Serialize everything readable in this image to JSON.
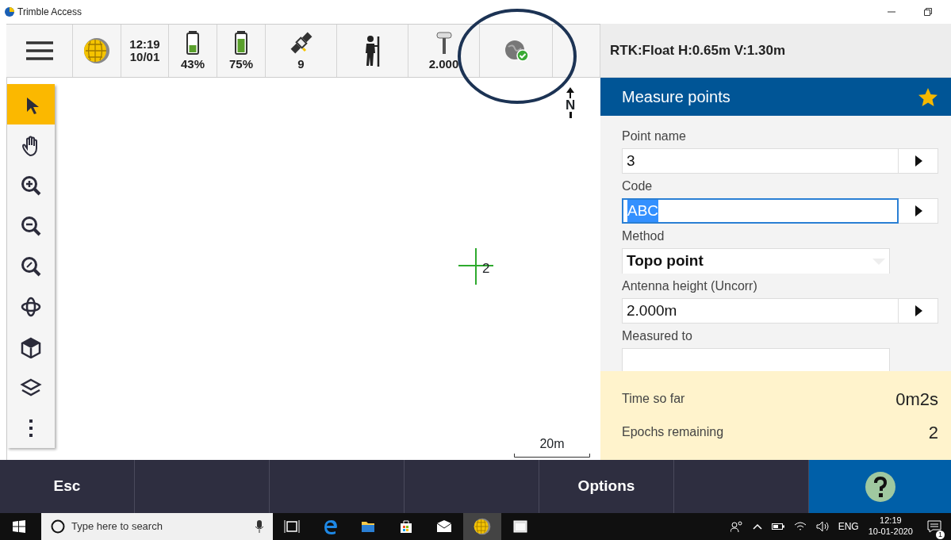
{
  "window": {
    "title": "Trimble Access"
  },
  "toolbar": {
    "items": [
      {
        "kind": "menu"
      },
      {
        "kind": "globe"
      },
      {
        "kind": "time",
        "line1": "12:19",
        "line2": "10/01"
      },
      {
        "kind": "battery",
        "label": "43%",
        "level": 0.43
      },
      {
        "kind": "battery",
        "label": "75%",
        "level": 0.75
      },
      {
        "kind": "satellite",
        "label": "9"
      },
      {
        "kind": "person"
      },
      {
        "kind": "antenna",
        "label": "2.000"
      },
      {
        "kind": "network"
      },
      {
        "kind": "blank"
      }
    ],
    "status": "RTK:Float H:0.65m V:1.30m"
  },
  "map": {
    "tools": [
      {
        "kind": "pointer",
        "selected": true
      },
      {
        "kind": "pan",
        "selected": false
      },
      {
        "kind": "zoom-in",
        "selected": false
      },
      {
        "kind": "zoom-out",
        "selected": false
      },
      {
        "kind": "zoom-extents",
        "selected": false
      },
      {
        "kind": "orbit",
        "selected": false
      },
      {
        "kind": "cube",
        "selected": false
      },
      {
        "kind": "layers",
        "selected": false
      },
      {
        "kind": "more",
        "selected": false
      }
    ],
    "north": "N",
    "point_label": "2",
    "scale": "20m"
  },
  "panel": {
    "title": "Measure points",
    "favorite": true,
    "fields": [
      {
        "kind": "input",
        "label": "Point name",
        "value": "3",
        "focused": false
      },
      {
        "kind": "input",
        "label": "Code",
        "value": "ABC",
        "focused": true
      },
      {
        "kind": "dropdown",
        "label": "Method",
        "value": "Topo point"
      },
      {
        "kind": "input",
        "label": "Antenna height (Uncorr)",
        "value": "2.000m",
        "focused": false
      },
      {
        "kind": "dropdown",
        "label": "Measured to"
      }
    ],
    "progress": [
      {
        "label": "Time so far",
        "value": "0m2s"
      },
      {
        "label": "Epochs remaining",
        "value": "2"
      }
    ]
  },
  "softkeys": [
    {
      "kind": "text",
      "label": "Esc"
    },
    {
      "kind": "empty"
    },
    {
      "kind": "empty"
    },
    {
      "kind": "empty"
    },
    {
      "kind": "text",
      "label": "Options"
    },
    {
      "kind": "empty"
    },
    {
      "kind": "help"
    }
  ],
  "taskbar": {
    "search_placeholder": "Type here to search",
    "apps": [
      {
        "kind": "taskview",
        "selected": false
      },
      {
        "kind": "edge",
        "selected": false
      },
      {
        "kind": "folder",
        "selected": false
      },
      {
        "kind": "store",
        "selected": false
      },
      {
        "kind": "mail",
        "selected": false
      },
      {
        "kind": "globe",
        "selected": true
      },
      {
        "kind": "window",
        "selected": false
      }
    ],
    "language": "ENG",
    "time": "12:19",
    "date": "10-01-2020",
    "notifications": "1"
  }
}
